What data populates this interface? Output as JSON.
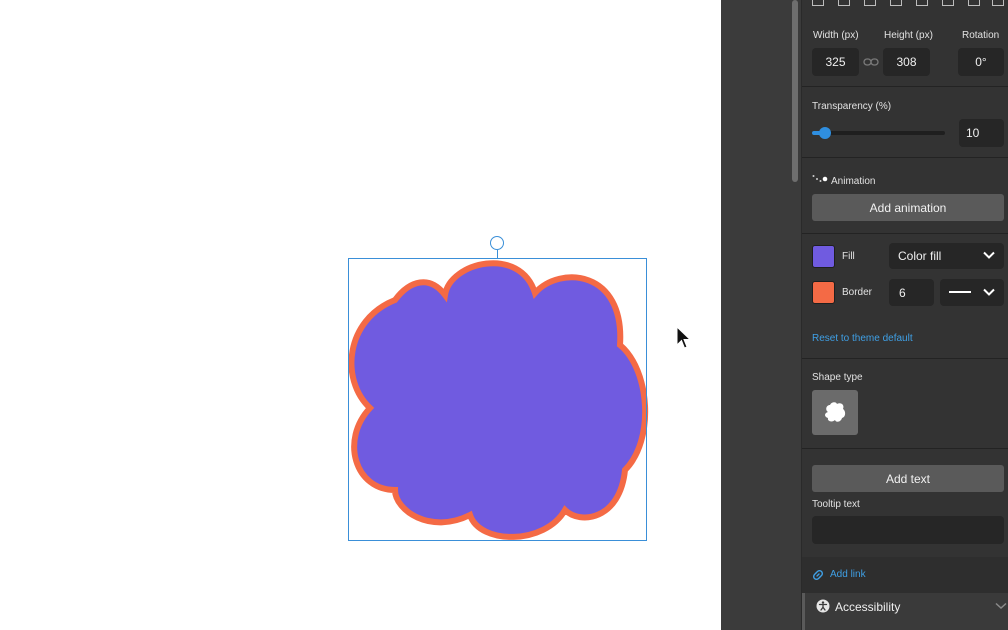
{
  "colors": {
    "fill": "#705be0",
    "border": "#f46a45",
    "selection": "#3a8fd8",
    "accent_link": "#3fa0e6",
    "slider": "#2f8fe0"
  },
  "size": {
    "width_label": "Width (px)",
    "height_label": "Height (px)",
    "rotation_label": "Rotation",
    "width_value": "325",
    "height_value": "308",
    "rotation_value": "0°",
    "link_icon": "chain-link-icon"
  },
  "transparency": {
    "label": "Transparency (%)",
    "value": "10",
    "level_percent": 10
  },
  "animation": {
    "label": "Animation",
    "button": "Add animation",
    "icon": "motion-dots-icon"
  },
  "style": {
    "fill_label": "Fill",
    "fill_type": "Color fill",
    "border_label": "Border",
    "border_width": "6",
    "reset_link": "Reset to theme default"
  },
  "shape": {
    "label": "Shape type",
    "icon": "cloud-icon"
  },
  "text": {
    "add_text": "Add text",
    "tooltip_label": "Tooltip text",
    "tooltip_value": ""
  },
  "link": {
    "label": "Add link",
    "icon": "link-icon"
  },
  "accessibility": {
    "label": "Accessibility",
    "icon": "accessibility-icon"
  }
}
